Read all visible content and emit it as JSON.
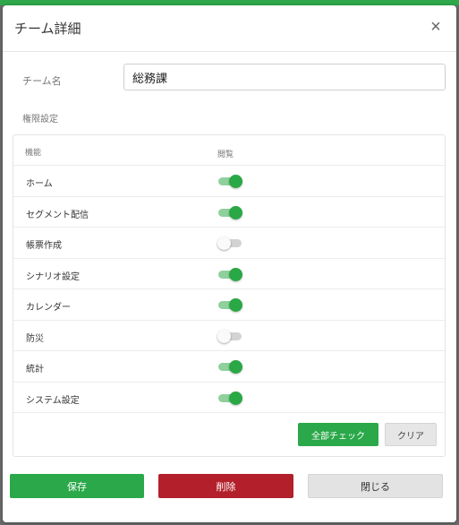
{
  "dialog": {
    "title": "チーム詳細",
    "close_icon": "close-icon",
    "close_glyph": "×"
  },
  "team_name": {
    "label": "チーム名",
    "value": "総務課"
  },
  "permissions": {
    "section_label": "権限設定",
    "header": {
      "function": "機能",
      "view": "閲覧"
    },
    "rows": [
      {
        "label": "ホーム",
        "view": true
      },
      {
        "label": "セグメント配信",
        "view": true
      },
      {
        "label": "帳票作成",
        "view": false
      },
      {
        "label": "シナリオ設定",
        "view": true
      },
      {
        "label": "カレンダー",
        "view": true
      },
      {
        "label": "防災",
        "view": false
      },
      {
        "label": "統計",
        "view": true
      },
      {
        "label": "システム設定",
        "view": true
      }
    ],
    "check_all_label": "全部チェック",
    "clear_label": "クリア"
  },
  "footer": {
    "save_label": "保存",
    "delete_label": "削除",
    "close_label": "閉じる"
  },
  "colors": {
    "accent_green": "#2aa84a",
    "danger_red": "#b31f2a",
    "toggle_on_track": "#8fd09c",
    "toggle_off_track": "#d3d3d3"
  }
}
